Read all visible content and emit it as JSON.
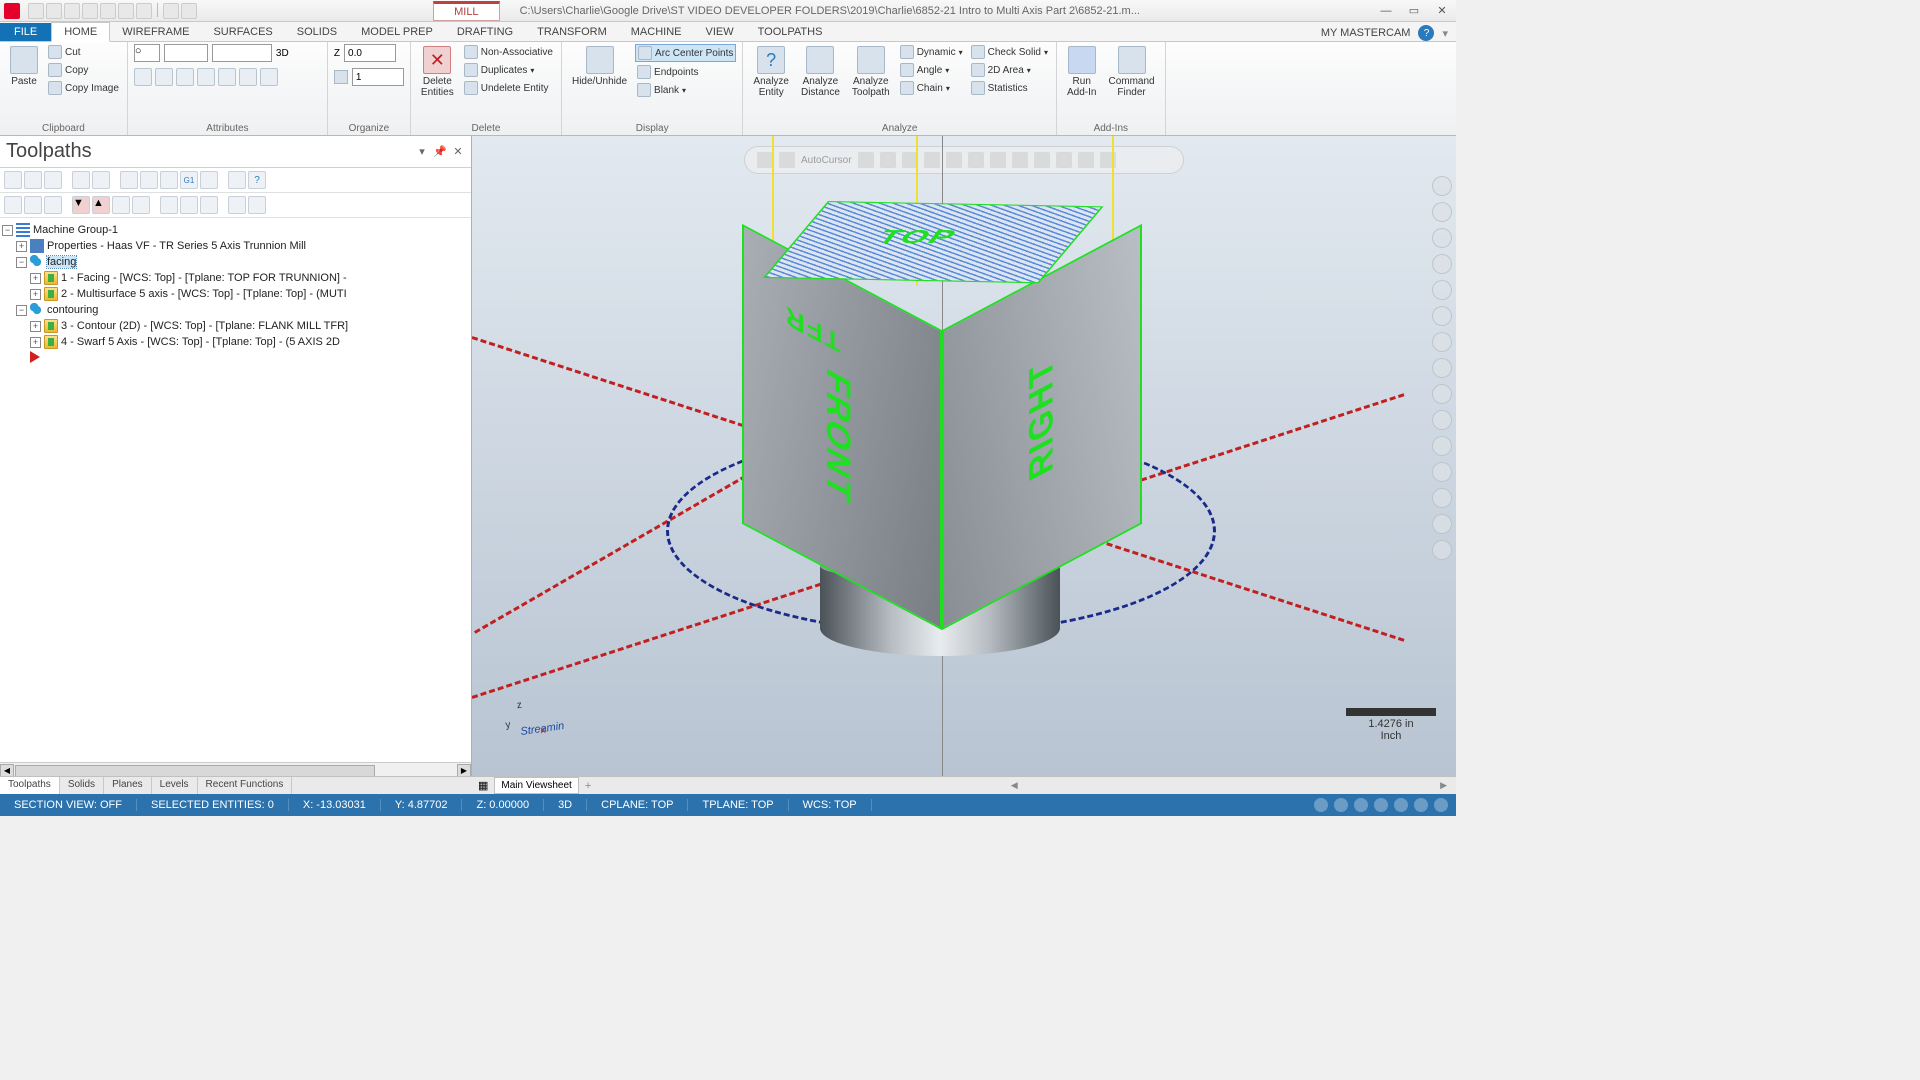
{
  "title": {
    "context_tab": "MILL",
    "path": "C:\\Users\\Charlie\\Google Drive\\ST VIDEO DEVELOPER FOLDERS\\2019\\Charlie\\6852-21 Intro to Multi Axis Part 2\\6852-21.m..."
  },
  "ribbon_tabs": {
    "file": "FILE",
    "items": [
      "HOME",
      "WIREFRAME",
      "SURFACES",
      "SOLIDS",
      "MODEL PREP",
      "DRAFTING",
      "TRANSFORM",
      "MACHINE",
      "VIEW",
      "TOOLPATHS"
    ],
    "active": "HOME",
    "my": "MY MASTERCAM"
  },
  "ribbon": {
    "clipboard": {
      "paste": "Paste",
      "cut": "Cut",
      "copy": "Copy",
      "copy_image": "Copy Image",
      "label": "Clipboard"
    },
    "attributes": {
      "z_label": "Z",
      "z_val": "0.0",
      "mode": "3D",
      "level_val": "1",
      "label": "Attributes"
    },
    "organize": {
      "z_label": "Z",
      "z_val": "0.0",
      "level_val": "1",
      "label": "Organize"
    },
    "delete": {
      "btn": "Delete\nEntities",
      "non_assoc": "Non-Associative",
      "dup": "Duplicates",
      "undel": "Undelete Entity",
      "label": "Delete"
    },
    "display": {
      "btn": "Hide/Unhide",
      "arc": "Arc Center Points",
      "end": "Endpoints",
      "blank": "Blank",
      "label": "Display"
    },
    "analyze": {
      "entity": "Analyze\nEntity",
      "distance": "Analyze\nDistance",
      "toolpath": "Analyze\nToolpath",
      "dynamic": "Dynamic",
      "angle": "Angle",
      "chain": "Chain",
      "check": "Check Solid",
      "area": "2D Area",
      "stats": "Statistics",
      "label": "Analyze"
    },
    "addins": {
      "run": "Run\nAdd-In",
      "cmd": "Command\nFinder",
      "label": "Add-Ins"
    }
  },
  "panel": {
    "title": "Toolpaths",
    "tree": {
      "root": "Machine Group-1",
      "props": "Properties - Haas VF - TR Series 5 Axis Trunnion Mill",
      "g1": "facing",
      "op1": "1 - Facing - [WCS: Top] - [Tplane: TOP FOR TRUNNION] -",
      "op2": "2 - Multisurface 5 axis - [WCS: Top] - [Tplane: Top] - (MUTI",
      "g2": "contouring",
      "op3": "3 - Contour (2D) - [WCS: Top] - [Tplane: FLANK MILL TFR]",
      "op4": "4 - Swarf 5 Axis - [WCS: Top] - [Tplane: Top] - (5 AXIS 2D"
    },
    "tabs": [
      "Toolpaths",
      "Solids",
      "Planes",
      "Levels",
      "Recent Functions"
    ]
  },
  "viewport": {
    "float_label": "AutoCursor",
    "faces": {
      "top": "TOP",
      "front_a": "TFR",
      "front_b": "FRONT",
      "right": "RIGHT"
    },
    "wcs_text": "Streamin",
    "scale_val": "1.4276 in",
    "scale_unit": "Inch",
    "viewsheet": "Main Viewsheet"
  },
  "status": {
    "section": "SECTION VIEW: OFF",
    "sel": "SELECTED ENTITIES: 0",
    "x": "X: -13.03031",
    "y": "Y: 4.87702",
    "z": "Z: 0.00000",
    "mode": "3D",
    "cplane": "CPLANE: TOP",
    "tplane": "TPLANE: TOP",
    "wcs": "WCS: TOP"
  }
}
